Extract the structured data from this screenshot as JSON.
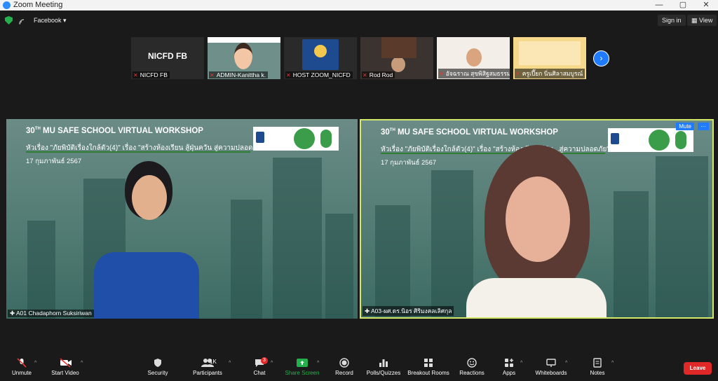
{
  "window": {
    "title": "Zoom Meeting",
    "minimize": "—",
    "maximize": "▢",
    "close": "✕"
  },
  "topbar": {
    "facebook": "Facebook ▾",
    "sign_in": "Sign in",
    "view": "▦ View"
  },
  "thumbnails": [
    {
      "name": "NICFD FB",
      "text": "NICFD FB"
    },
    {
      "name": "ADMIN-Kanittha k."
    },
    {
      "name": "HOST ZOOM_NICFD"
    },
    {
      "name": "Rod Rod"
    },
    {
      "name": "อัจฉราณ สุขพิสิฐสมธรรม"
    },
    {
      "name": "ครูเปี๊ยก นิ่นศิลาสมบูรณ์"
    }
  ],
  "workshop": {
    "title_pre": "30",
    "title_sup": "TH",
    "title_post": " MU SAFE SCHOOL VIRTUAL WORKSHOP",
    "subtitle_left": "หัวเรื่อง \"ภัยพิบัติเรื่องใกล้ตัว(4)\" เรื่อง \"สร้างห้องเรียน สู้ฝุ่นควัน สู่ความปลอดภัย\"",
    "subtitle_right": "หัวเรื่อง \"ภัยพิบัติเรื่องใกล้ตัว(4)\" เรื่อง \"สร้างห้องเรียน สู้ฝุ่น...สู่ความปลอดภัย\"",
    "date": "17 กุมภาพันธ์ 2567"
  },
  "speakers": {
    "left": "A01 Chadaphorn Suksiriwan",
    "right": "A03-ผศ.ดร.นิอร ศิริมงคลเลิศกุล",
    "mute": "Mute",
    "more": "···"
  },
  "toolbar": {
    "unmute": "Unmute",
    "start_video": "Start Video",
    "security": "Security",
    "participants": "Participants",
    "participants_count": "1K",
    "chat": "Chat",
    "chat_badge": "3",
    "share_screen": "Share Screen",
    "record": "Record",
    "polls": "Polls/Quizzes",
    "breakout": "Breakout Rooms",
    "reactions": "Reactions",
    "apps": "Apps",
    "whiteboards": "Whiteboards",
    "notes": "Notes",
    "leave": "Leave"
  },
  "colors": {
    "accent": "#2d8cff",
    "share": "#23b14d",
    "leave": "#e02828",
    "active": "#d4e86a"
  }
}
